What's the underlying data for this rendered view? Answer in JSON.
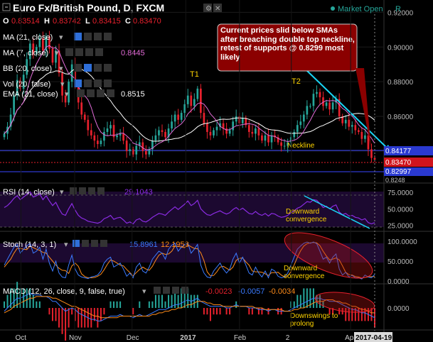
{
  "header": {
    "title": "Euro Fx/British Pound, D, FXCM",
    "market_status": "Market Open",
    "market_flag": "R",
    "ohlc": {
      "o_label": "O",
      "o": "0.83514",
      "h_label": "H",
      "h": "0.83742",
      "l_label": "L",
      "l": "0.83415",
      "c_label": "C",
      "c": "0.83470"
    }
  },
  "indicators": [
    {
      "label": "MA (21, close)",
      "value": ""
    },
    {
      "label": "MA (7, close)",
      "value": "0.8445"
    },
    {
      "label": "BB (20, close)",
      "value": ""
    },
    {
      "label": "Vol (20, false)",
      "value": ""
    },
    {
      "label": "EMA (21, close)",
      "value": "0.8515"
    }
  ],
  "annotation": "Current prices slid below SMAs after breaching double top neckline, retest of supports @ 0.8299 most likely",
  "labels": {
    "t1": "T1",
    "t2": "T2",
    "neckline": "Neckline"
  },
  "rsi": {
    "label": "RSI (14, close)",
    "value": "29.1043",
    "note": "Downward convergence"
  },
  "stoch": {
    "label": "Stoch (14, 3, 1)",
    "k": "15.8961",
    "d": "12.1953",
    "note": "Downward convergence"
  },
  "macd": {
    "label": "MACD (12, 26, close, 9, false, true)",
    "v1": "-0.0023",
    "v2": "-0.0057",
    "v3": "-0.0034",
    "note": "Downswings to prolong"
  },
  "colors": {
    "up": "#26a69a",
    "down": "#e8212d",
    "ma21": "#ffffff",
    "ma7": "#e36cd8",
    "ema": "#e8212d",
    "neckline": "#3a46ff",
    "trendline": "#19d5f5",
    "rsi": "#8a2be2",
    "stoch_k": "#3b7bff",
    "stoch_d": "#ff8c1a",
    "macd_line": "#3b7bff",
    "signal": "#ff8c1a",
    "annotation_bg": "#8b0000"
  },
  "chart_data": {
    "type": "candlestick",
    "price_axis": {
      "ticks": [
        "0.92000",
        "0.90000",
        "0.88000",
        "0.86000",
        "0.84000"
      ],
      "ylim": [
        0.8215,
        0.9255
      ]
    },
    "price_labels": {
      "neckline": "0.84177",
      "current": "0.83470",
      "support": "0.82997",
      "bottom": "0.8248"
    },
    "x_ticks": [
      "Oct",
      "Nov",
      "Dec",
      "2017",
      "Feb",
      "2",
      "Apr"
    ],
    "current_date": "2017-04-19",
    "rsi_ticks": [
      "75.0000",
      "50.0000",
      "25.0000"
    ],
    "stoch_ticks": [
      "100.0000",
      "50.0000",
      "0.0000"
    ],
    "macd_ticks": [
      "0.0000"
    ],
    "closes": [
      0.85,
      0.854,
      0.861,
      0.872,
      0.881,
      0.876,
      0.884,
      0.893,
      0.902,
      0.896,
      0.9,
      0.905,
      0.898,
      0.906,
      0.899,
      0.891,
      0.898,
      0.885,
      0.872,
      0.868,
      0.88,
      0.89,
      0.878,
      0.868,
      0.861,
      0.858,
      0.852,
      0.849,
      0.846,
      0.844,
      0.846,
      0.851,
      0.853,
      0.855,
      0.848,
      0.849,
      0.85,
      0.846,
      0.84,
      0.841,
      0.838,
      0.843,
      0.845,
      0.84,
      0.838,
      0.841,
      0.846,
      0.849,
      0.852,
      0.851,
      0.848,
      0.853,
      0.857,
      0.861,
      0.858,
      0.862,
      0.867,
      0.872,
      0.866,
      0.87,
      0.876,
      0.862,
      0.856,
      0.851,
      0.849,
      0.852,
      0.854,
      0.856,
      0.853,
      0.85,
      0.852,
      0.857,
      0.86,
      0.856,
      0.859,
      0.855,
      0.851,
      0.85,
      0.853,
      0.849,
      0.846,
      0.849,
      0.845,
      0.849,
      0.848,
      0.845,
      0.843,
      0.843,
      0.845,
      0.848,
      0.851,
      0.855,
      0.857,
      0.861,
      0.866,
      0.866,
      0.873,
      0.874,
      0.871,
      0.866,
      0.868,
      0.864,
      0.868,
      0.87,
      0.86,
      0.856,
      0.858,
      0.854,
      0.855,
      0.852,
      0.851,
      0.847,
      0.849,
      0.841,
      0.836,
      0.835
    ],
    "rsi": [
      52,
      55,
      60,
      66,
      70,
      64,
      68,
      72,
      76,
      68,
      70,
      73,
      64,
      70,
      62,
      55,
      60,
      50,
      42,
      40,
      50,
      58,
      48,
      40,
      36,
      34,
      31,
      30,
      29,
      28,
      30,
      35,
      37,
      40,
      34,
      36,
      37,
      33,
      28,
      30,
      27,
      33,
      35,
      31,
      30,
      33,
      37,
      40,
      43,
      42,
      40,
      45,
      49,
      53,
      49,
      53,
      57,
      62,
      55,
      58,
      63,
      50,
      45,
      41,
      40,
      43,
      45,
      47,
      44,
      42,
      44,
      49,
      52,
      48,
      51,
      47,
      43,
      42,
      46,
      42,
      40,
      43,
      39,
      43,
      42,
      39,
      37,
      38,
      40,
      44,
      47,
      51,
      53,
      57,
      61,
      60,
      64,
      63,
      58,
      52,
      54,
      50,
      54,
      56,
      45,
      41,
      43,
      39,
      40,
      37,
      36,
      33,
      35,
      29,
      27,
      29
    ],
    "stoch_k": [
      40,
      55,
      70,
      85,
      92,
      70,
      80,
      88,
      95,
      70,
      75,
      85,
      55,
      80,
      45,
      25,
      50,
      20,
      10,
      8,
      40,
      65,
      30,
      15,
      10,
      8,
      6,
      10,
      12,
      15,
      25,
      45,
      55,
      60,
      35,
      40,
      45,
      30,
      12,
      20,
      8,
      35,
      45,
      25,
      20,
      35,
      55,
      65,
      75,
      70,
      55,
      80,
      90,
      95,
      75,
      85,
      92,
      95,
      70,
      80,
      92,
      40,
      20,
      10,
      8,
      25,
      35,
      45,
      30,
      20,
      30,
      55,
      70,
      45,
      60,
      40,
      20,
      15,
      35,
      20,
      10,
      25,
      8,
      30,
      25,
      12,
      8,
      10,
      20,
      40,
      60,
      80,
      88,
      95,
      98,
      95,
      98,
      94,
      75,
      55,
      60,
      45,
      60,
      68,
      30,
      15,
      22,
      10,
      14,
      8,
      8,
      5,
      15,
      10,
      8,
      16
    ],
    "stoch_d": [
      35,
      45,
      55,
      70,
      82,
      82,
      80,
      79,
      88,
      84,
      80,
      77,
      72,
      70,
      60,
      50,
      40,
      32,
      27,
      26,
      19,
      38,
      45,
      37,
      18,
      11,
      8,
      8,
      9,
      12,
      17,
      28,
      42,
      53,
      50,
      45,
      40,
      38,
      29,
      21,
      13,
      21,
      29,
      35,
      30,
      27,
      37,
      52,
      65,
      70,
      67,
      68,
      75,
      88,
      87,
      85,
      84,
      91,
      86,
      82,
      81,
      71,
      51,
      23,
      13,
      14,
      23,
      35,
      37,
      32,
      27,
      35,
      52,
      57,
      58,
      48,
      40,
      25,
      23,
      23,
      22,
      18,
      14,
      21,
      21,
      22,
      15,
      10,
      13,
      23,
      40,
      60,
      76,
      88,
      94,
      96,
      97,
      96,
      89,
      75,
      63,
      53,
      55,
      58,
      53,
      38,
      22,
      16,
      15,
      11,
      10,
      7,
      9,
      10,
      11,
      11
    ],
    "macd": [
      -0.002,
      0.0,
      0.002,
      0.004,
      0.006,
      0.006,
      0.007,
      0.008,
      0.009,
      0.008,
      0.008,
      0.008,
      0.007,
      0.007,
      0.006,
      0.004,
      0.004,
      0.002,
      0.0,
      -0.002,
      -0.001,
      0.0,
      -0.001,
      -0.003,
      -0.004,
      -0.005,
      -0.006,
      -0.007,
      -0.007,
      -0.008,
      -0.008,
      -0.007,
      -0.006,
      -0.005,
      -0.005,
      -0.005,
      -0.004,
      -0.005,
      -0.005,
      -0.005,
      -0.006,
      -0.005,
      -0.004,
      -0.005,
      -0.005,
      -0.004,
      -0.003,
      -0.002,
      -0.001,
      -0.001,
      -0.001,
      0.0,
      0.001,
      0.002,
      0.002,
      0.003,
      0.004,
      0.005,
      0.004,
      0.005,
      0.006,
      0.004,
      0.003,
      0.002,
      0.001,
      0.001,
      0.001,
      0.001,
      0.001,
      0.0,
      0.0,
      0.001,
      0.002,
      0.001,
      0.001,
      0.001,
      0.0,
      0.0,
      0.0,
      -0.001,
      -0.001,
      -0.001,
      -0.002,
      -0.001,
      -0.001,
      -0.002,
      -0.002,
      -0.002,
      -0.002,
      -0.001,
      0.0,
      0.001,
      0.002,
      0.003,
      0.004,
      0.005,
      0.006,
      0.006,
      0.006,
      0.005,
      0.005,
      0.004,
      0.004,
      0.004,
      0.003,
      0.002,
      0.001,
      0.0,
      -0.001,
      -0.001,
      -0.002,
      -0.003,
      -0.003,
      -0.004,
      -0.005,
      -0.006
    ],
    "signal": [
      -0.003,
      -0.002,
      -0.001,
      0.001,
      0.002,
      0.003,
      0.004,
      0.005,
      0.006,
      0.006,
      0.007,
      0.007,
      0.007,
      0.007,
      0.007,
      0.006,
      0.006,
      0.005,
      0.004,
      0.003,
      0.002,
      0.001,
      0.001,
      0.0,
      -0.001,
      -0.002,
      -0.003,
      -0.004,
      -0.005,
      -0.005,
      -0.006,
      -0.006,
      -0.006,
      -0.006,
      -0.006,
      -0.006,
      -0.005,
      -0.005,
      -0.005,
      -0.005,
      -0.005,
      -0.005,
      -0.005,
      -0.005,
      -0.005,
      -0.005,
      -0.004,
      -0.004,
      -0.003,
      -0.003,
      -0.002,
      -0.002,
      -0.001,
      -0.001,
      0.0,
      0.0,
      0.001,
      0.002,
      0.002,
      0.003,
      0.004,
      0.004,
      0.004,
      0.003,
      0.003,
      0.002,
      0.002,
      0.002,
      0.001,
      0.001,
      0.001,
      0.001,
      0.001,
      0.001,
      0.001,
      0.001,
      0.001,
      0.001,
      0.0,
      0.0,
      0.0,
      -0.001,
      -0.001,
      -0.001,
      -0.001,
      -0.001,
      -0.001,
      -0.002,
      -0.002,
      -0.002,
      -0.001,
      -0.001,
      0.0,
      0.0,
      0.001,
      0.002,
      0.003,
      0.004,
      0.004,
      0.004,
      0.005,
      0.005,
      0.005,
      0.004,
      0.004,
      0.003,
      0.003,
      0.002,
      0.001,
      0.001,
      0.0,
      -0.001,
      -0.001,
      -0.002,
      -0.003,
      -0.003
    ]
  }
}
